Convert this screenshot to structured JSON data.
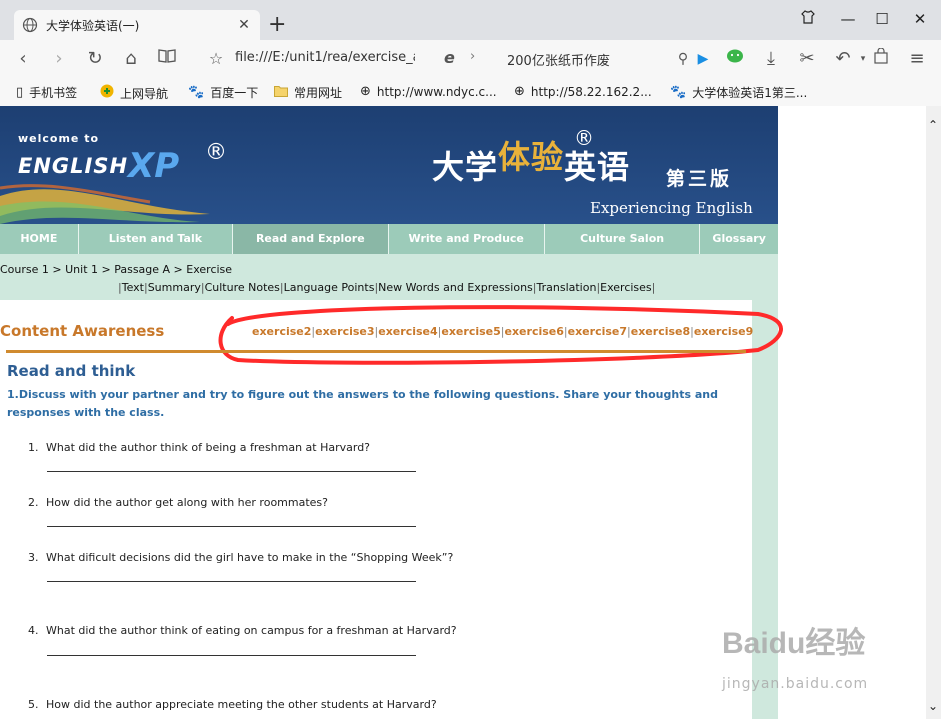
{
  "browser": {
    "tab_title": "大学体验英语(一)",
    "address": "file:///E:/unit1/rea/exercise_a",
    "hot_search": "200亿张纸币作废",
    "bookmarks": [
      {
        "label": "手机书签",
        "icon": "phone-icon"
      },
      {
        "label": "上网导航",
        "icon": "navigation-icon"
      },
      {
        "label": "百度一下",
        "icon": "paw-icon"
      },
      {
        "label": "常用网址",
        "icon": "folder-icon"
      },
      {
        "label": "http://www.ndyc.c...",
        "icon": "globe-icon"
      },
      {
        "label": "http://58.22.162.2...",
        "icon": "globe-icon"
      },
      {
        "label": "大学体验英语1第三...",
        "icon": "paw-icon"
      }
    ]
  },
  "banner": {
    "welcome": "welcome to",
    "english": "ENGLISH",
    "xp": "XP",
    "reg": "®",
    "cn_title_1": "大学",
    "cn_title_2": "体验",
    "cn_title_3": "英语",
    "cn_edition": "第三版",
    "subtitle": "Experiencing English"
  },
  "menu": [
    "HOME",
    "Listen and Talk",
    "Read and Explore",
    "Write and Produce",
    "Culture Salon",
    "Glossary"
  ],
  "breadcrumb": "Course 1 > Unit 1 > Passage A > Exercise",
  "subnav": [
    "Text",
    "Summary",
    "Culture Notes",
    "Language Points",
    "New Words and Expressions",
    "Translation",
    "Exercises"
  ],
  "content": {
    "title": "Content Awareness",
    "exercise_links": [
      "exercise2",
      "exercise3",
      "exercise4",
      "exercise5",
      "exercise6",
      "exercise7",
      "exercise8",
      "exercise9"
    ],
    "section_title": "Read and think",
    "instruction": "1.Discuss with your partner and try to figure out the answers to the following questions. Share your thoughts and responses with the class.",
    "questions": [
      {
        "num": "1.",
        "text": "What did the author think of being a freshman at Harvard?"
      },
      {
        "num": "2.",
        "text": "How did the author get along with her roommates?"
      },
      {
        "num": "3.",
        "text": "What dificult decisions did the girl have to make in the “Shopping Week”?"
      },
      {
        "num": "4.",
        "text": "What did the author think of eating on campus for a freshman at Harvard?"
      },
      {
        "num": "5.",
        "text": "How did the author appreciate meeting the other students at Harvard?"
      }
    ]
  },
  "watermark": {
    "logo": "Baidu经验",
    "url": "jingyan.baidu.com"
  },
  "colors": {
    "banner": "#1d3f72",
    "menu": "#9ccbb9",
    "side": "#cfe8dd",
    "accent_orange": "#c8782a",
    "heading_blue": "#2e5e93",
    "annotation_red": "#ff2a2a"
  }
}
